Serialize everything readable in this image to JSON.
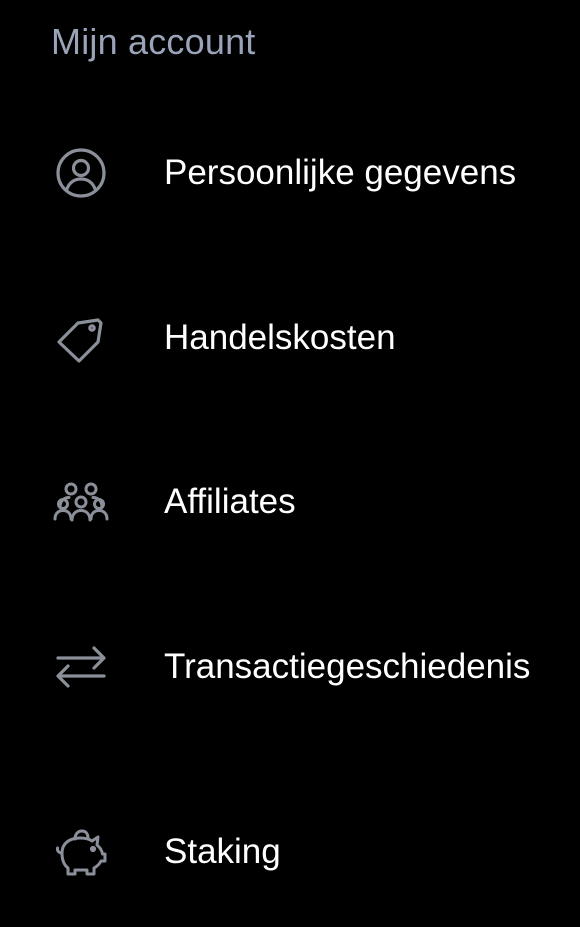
{
  "header": {
    "title": "Mijn account"
  },
  "colors": {
    "background": "#000000",
    "header_text": "#9aa3b8",
    "item_text": "#ffffff",
    "icon_stroke": "#8a8f99"
  },
  "menu": {
    "items": [
      {
        "label": "Persoonlijke gegevens",
        "icon": "user-circle-icon"
      },
      {
        "label": "Handelskosten",
        "icon": "price-tag-icon"
      },
      {
        "label": "Affiliates",
        "icon": "people-group-icon"
      },
      {
        "label": "Transactiegeschiedenis",
        "icon": "swap-arrows-icon"
      },
      {
        "label": "Staking",
        "icon": "piggy-bank-icon"
      }
    ]
  }
}
